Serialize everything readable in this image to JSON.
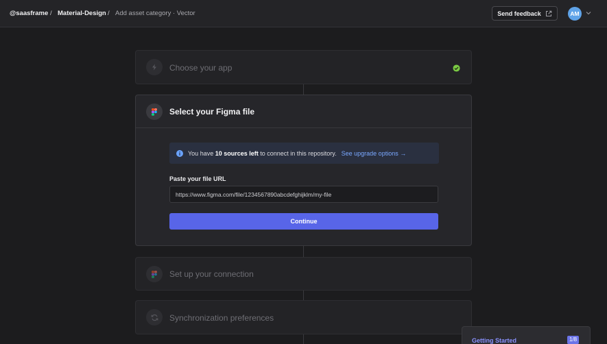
{
  "breadcrumb": {
    "org": "@saasframe",
    "separator": "/",
    "project": "Material-Design",
    "page": "Add asset category · Vector"
  },
  "header": {
    "feedback_label": "Send feedback",
    "avatar_initials": "AM"
  },
  "steps": [
    {
      "title": "Choose your app",
      "state": "completed",
      "icon": "bolt-icon"
    },
    {
      "title": "Select your Figma file",
      "state": "active",
      "icon": "figma-icon"
    },
    {
      "title": "Set up your connection",
      "state": "pending",
      "icon": "figma-icon"
    },
    {
      "title": "Synchronization preferences",
      "state": "pending",
      "icon": "sync-icon"
    }
  ],
  "info_banner": {
    "prefix": "You have ",
    "highlight": "10 sources left",
    "suffix": " to connect in this repository.",
    "link": "See upgrade options →"
  },
  "form": {
    "url_label": "Paste your file URL",
    "url_value": "https://www.figma.com/file/1234567890abcdefghijklm/my-file",
    "continue_label": "Continue"
  },
  "getting_started": {
    "title": "Getting Started",
    "progress": "1/8"
  },
  "colors": {
    "accent": "#5865e8",
    "success": "#7ac943",
    "link": "#7aa8ff"
  }
}
